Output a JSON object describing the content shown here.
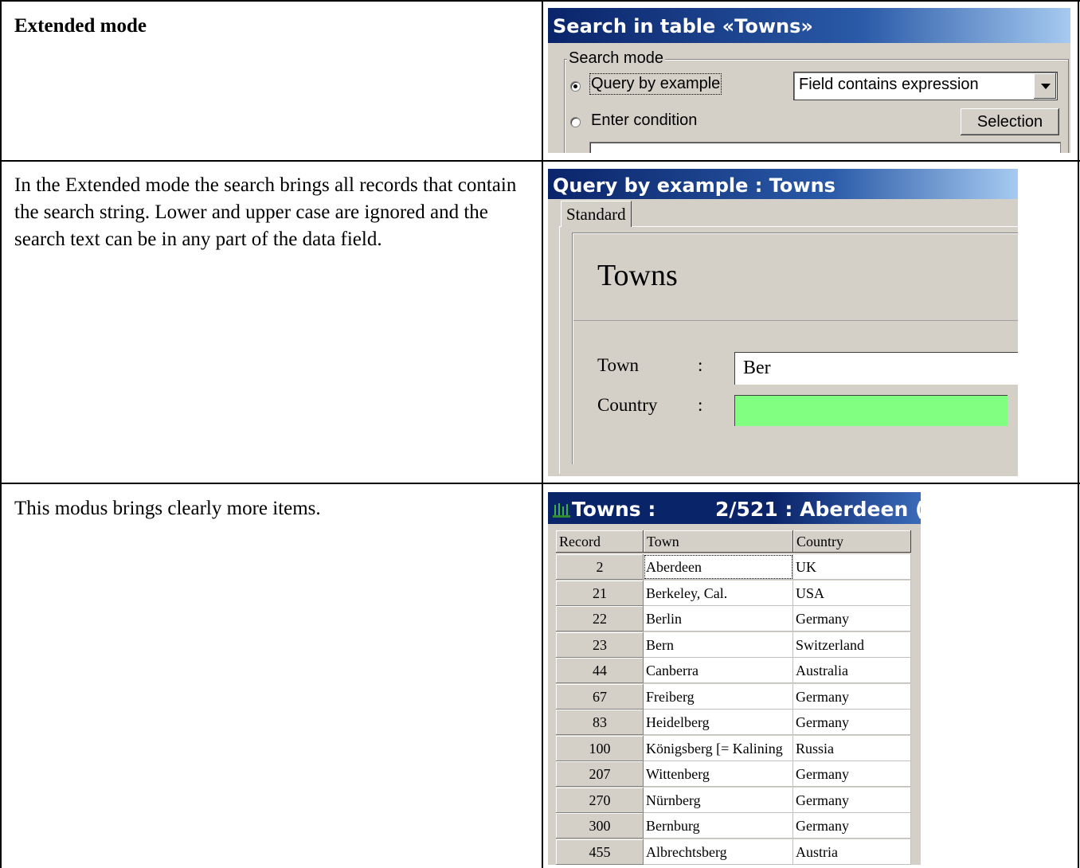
{
  "rows": [
    {
      "text": "Extended mode"
    },
    {
      "text": "In the Extended mode the search brings all records that contain the search string. Lower and upper case are ignored and the search text can be in any part of the data field."
    },
    {
      "text": "This modus brings clearly more items."
    }
  ],
  "search_dialog": {
    "title": "Search in table «Towns»",
    "group_label": "Search mode",
    "option_qbe": "Query by example",
    "option_condition": "Enter condition",
    "combo_value": "Field contains expression",
    "selection_button": "Selection",
    "selected_option": "Query by example"
  },
  "qbe_dialog": {
    "title": "Query by example : Towns",
    "tab_label": "Standard",
    "heading": "Towns",
    "fields": [
      {
        "label": "Town",
        "colon": ":",
        "value": "Ber"
      },
      {
        "label": "Country",
        "colon": ":",
        "value": ""
      }
    ],
    "country_highlight_color": "#80ff80"
  },
  "towns_window": {
    "title": "Towns :",
    "status": "2/521 : Aberdeen (",
    "columns": [
      "Record",
      "Town",
      "Country"
    ],
    "table": [
      {
        "record": "2",
        "town": "Aberdeen",
        "country": "UK"
      },
      {
        "record": "21",
        "town": "Berkeley, Cal.",
        "country": "USA"
      },
      {
        "record": "22",
        "town": "Berlin",
        "country": "Germany"
      },
      {
        "record": "23",
        "town": "Bern",
        "country": "Switzerland"
      },
      {
        "record": "44",
        "town": "Canberra",
        "country": "Australia"
      },
      {
        "record": "67",
        "town": "Freiberg",
        "country": "Germany"
      },
      {
        "record": "83",
        "town": "Heidelberg",
        "country": "Germany"
      },
      {
        "record": "100",
        "town": "Königsberg [= Kalining",
        "country": "Russia"
      },
      {
        "record": "207",
        "town": "Wittenberg",
        "country": "Germany"
      },
      {
        "record": "270",
        "town": "Nürnberg",
        "country": "Germany"
      },
      {
        "record": "300",
        "town": "Bernburg",
        "country": "Germany"
      },
      {
        "record": "455",
        "town": "Albrechtsberg",
        "country": "Austria"
      }
    ]
  }
}
